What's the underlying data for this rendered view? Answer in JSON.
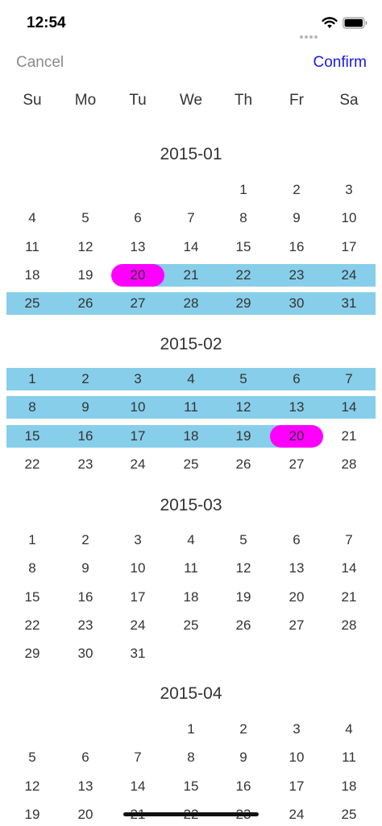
{
  "status_bar": {
    "time": "12:54",
    "icons": [
      "signal-icon",
      "wifi-icon",
      "battery-icon"
    ]
  },
  "nav": {
    "cancel_label": "Cancel",
    "confirm_label": "Confirm"
  },
  "weekdays": [
    "Su",
    "Mo",
    "Tu",
    "We",
    "Th",
    "Fr",
    "Sa"
  ],
  "colors": {
    "range": "#87ceea",
    "selected": "#ff00ff",
    "confirm": "#1a1ae6",
    "cancel": "#8a8a8a"
  },
  "selection": {
    "start": "2015-01-20",
    "end": "2015-02-20"
  },
  "months": [
    {
      "title": "2015-01",
      "weeks": [
        [
          "",
          "",
          "",
          "",
          "1",
          "2",
          "3"
        ],
        [
          "4",
          "5",
          "6",
          "7",
          "8",
          "9",
          "10"
        ],
        [
          "11",
          "12",
          "13",
          "14",
          "15",
          "16",
          "17"
        ],
        [
          "18",
          "19",
          "20",
          "21",
          "22",
          "23",
          "24"
        ],
        [
          "25",
          "26",
          "27",
          "28",
          "29",
          "30",
          "31"
        ]
      ]
    },
    {
      "title": "2015-02",
      "weeks": [
        [
          "1",
          "2",
          "3",
          "4",
          "5",
          "6",
          "7"
        ],
        [
          "8",
          "9",
          "10",
          "11",
          "12",
          "13",
          "14"
        ],
        [
          "15",
          "16",
          "17",
          "18",
          "19",
          "20",
          "21"
        ],
        [
          "22",
          "23",
          "24",
          "25",
          "26",
          "27",
          "28"
        ]
      ]
    },
    {
      "title": "2015-03",
      "weeks": [
        [
          "1",
          "2",
          "3",
          "4",
          "5",
          "6",
          "7"
        ],
        [
          "8",
          "9",
          "10",
          "11",
          "12",
          "13",
          "14"
        ],
        [
          "15",
          "16",
          "17",
          "18",
          "19",
          "20",
          "21"
        ],
        [
          "22",
          "23",
          "24",
          "25",
          "26",
          "27",
          "28"
        ],
        [
          "29",
          "30",
          "31",
          "",
          "",
          "",
          ""
        ]
      ]
    },
    {
      "title": "2015-04",
      "weeks": [
        [
          "",
          "",
          "",
          "1",
          "2",
          "3",
          "4"
        ],
        [
          "5",
          "6",
          "7",
          "8",
          "9",
          "10",
          "11"
        ],
        [
          "12",
          "13",
          "14",
          "15",
          "16",
          "17",
          "18"
        ],
        [
          "19",
          "20",
          "21",
          "22",
          "23",
          "24",
          "25"
        ]
      ]
    }
  ]
}
